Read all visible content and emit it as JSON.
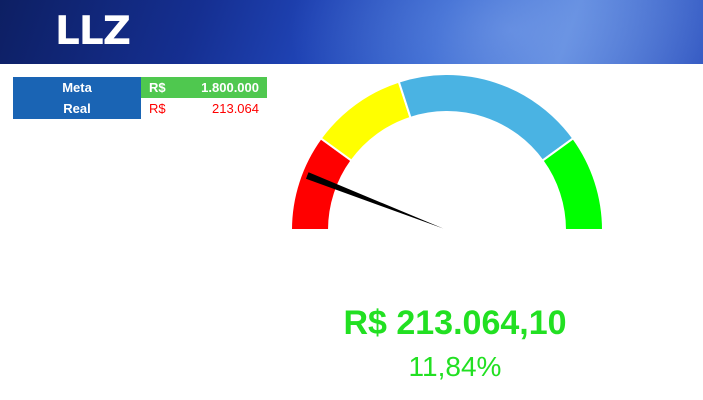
{
  "header": {
    "logo_text": "LLZ"
  },
  "kpi_table": {
    "rows": [
      {
        "label": "Meta",
        "currency": "R$",
        "value": "1.800.000"
      },
      {
        "label": "Real",
        "currency": "R$",
        "value": "213.064"
      }
    ]
  },
  "gauge": {
    "value": 213064.1,
    "max": 1800000,
    "bands": [
      {
        "name": "red",
        "color": "#ff0000",
        "from": 0,
        "to": 0.2
      },
      {
        "name": "yellow",
        "color": "#ffff00",
        "from": 0.2,
        "to": 0.4
      },
      {
        "name": "blue",
        "color": "#4ab3e3",
        "from": 0.4,
        "to": 0.8
      },
      {
        "name": "green",
        "color": "#00ff00",
        "from": 0.8,
        "to": 1.0
      }
    ]
  },
  "result": {
    "amount": "R$ 213.064,10",
    "percent": "11,84%"
  },
  "colors": {
    "banner": "#1f43b4",
    "label_bg": "#1a64b4",
    "meta_bg": "#4fc84f",
    "real_text": "#ff0000",
    "result_text": "#22e022"
  }
}
